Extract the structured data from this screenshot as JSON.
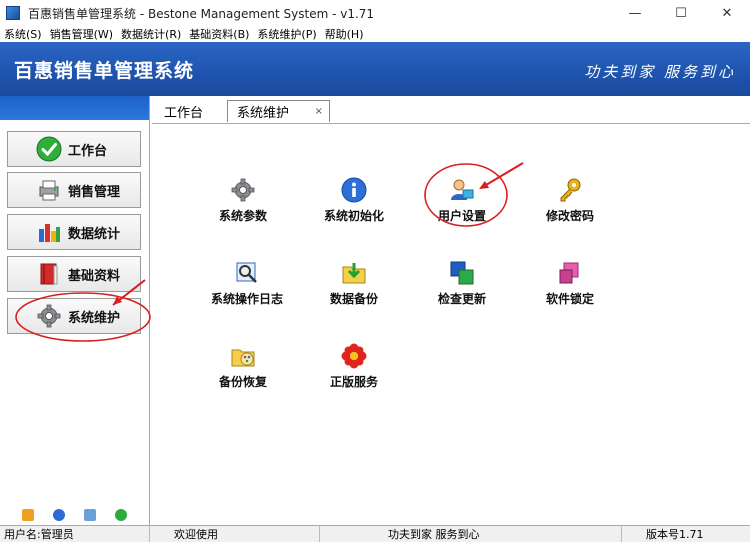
{
  "window": {
    "title": "百惠销售单管理系统 - Bestone Management System - v1.71",
    "minimize": "—",
    "maximize": "☐",
    "close": "✕"
  },
  "menubar": {
    "items": [
      "系统(S)",
      "销售管理(W)",
      "数据统计(R)",
      "基础资料(B)",
      "系统维护(P)",
      "帮助(H)"
    ]
  },
  "banner": {
    "title": "百惠销售单管理系统",
    "slogan": "功夫到家 服务到心"
  },
  "sidebar": {
    "items": [
      {
        "label": "工作台",
        "icon": "check-icon"
      },
      {
        "label": "销售管理",
        "icon": "printer-icon"
      },
      {
        "label": "数据统计",
        "icon": "chart-icon"
      },
      {
        "label": "基础资料",
        "icon": "book-icon"
      },
      {
        "label": "系统维护",
        "icon": "gear-icon"
      }
    ],
    "selected": "系统维护",
    "footer_icons": [
      "key-icon",
      "clock-icon",
      "monitor-icon",
      "exit-icon"
    ]
  },
  "tabs": {
    "home": "工作台",
    "active": "系统维护",
    "close": "×"
  },
  "functions": [
    {
      "label": "系统参数",
      "icon": "gear-icon"
    },
    {
      "label": "系统初始化",
      "icon": "info-icon"
    },
    {
      "label": "用户设置",
      "icon": "user-icon"
    },
    {
      "label": "修改密码",
      "icon": "key-icon"
    },
    {
      "label": "系统操作日志",
      "icon": "log-search-icon"
    },
    {
      "label": "数据备份",
      "icon": "folder-download-icon"
    },
    {
      "label": "检查更新",
      "icon": "update-icon"
    },
    {
      "label": "软件锁定",
      "icon": "lock-icon"
    },
    {
      "label": "备份恢复",
      "icon": "folder-palette-icon"
    },
    {
      "label": "正版服务",
      "icon": "flower-icon"
    }
  ],
  "statusbar": {
    "user": "用户名:管理员",
    "welcome": "欢迎使用",
    "slogan": "功夫到家 服务到心",
    "version": "版本号1.71"
  },
  "colors": {
    "banner": "#1e55b0",
    "sidebar_head": "#2a78df",
    "annotation": "#d81e1e"
  }
}
